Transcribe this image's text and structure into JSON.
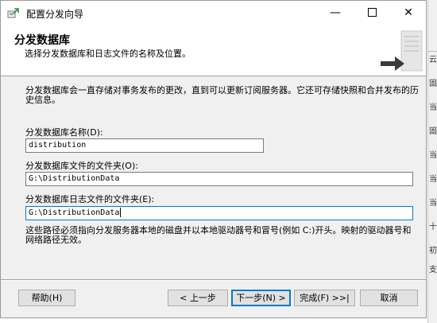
{
  "window": {
    "title": "配置分发向导",
    "minimize_glyph": "—",
    "close_glyph": "✕"
  },
  "header": {
    "title": "分发数据库",
    "subtitle": "选择分发数据库和日志文件的名称及位置。"
  },
  "description": "分发数据库会一直存储对事务发布的更改，直到可以更新订阅服务器。它还可存储快照和合并发布的历史信息。",
  "fields": {
    "db_name": {
      "label": "分发数据库名称(D):",
      "value": "distribution"
    },
    "data_folder": {
      "label": "分发数据库文件的文件夹(O):",
      "value": "G:\\DistributionData"
    },
    "log_folder": {
      "label": "分发数据库日志文件的文件夹(E):",
      "value": "G:\\DistributionData"
    }
  },
  "note": "这些路径必须指向分发服务器本地的磁盘并以本地驱动器号和冒号(例如 C:)开头。映射的驱动器号和网络路径无效。",
  "buttons": {
    "help": "帮助(H)",
    "back": "< 上一步",
    "next": "下一步(N) >",
    "finish": "完成(F) >>|",
    "cancel": "取消"
  },
  "background_app_glyphs": [
    "云",
    "固",
    "当",
    "固",
    "当",
    "当",
    "当",
    "十",
    "初",
    "支"
  ],
  "colors": {
    "focus_border": "#0078d7",
    "window_bg": "#f0f0f0",
    "header_bg": "#ffffff"
  }
}
